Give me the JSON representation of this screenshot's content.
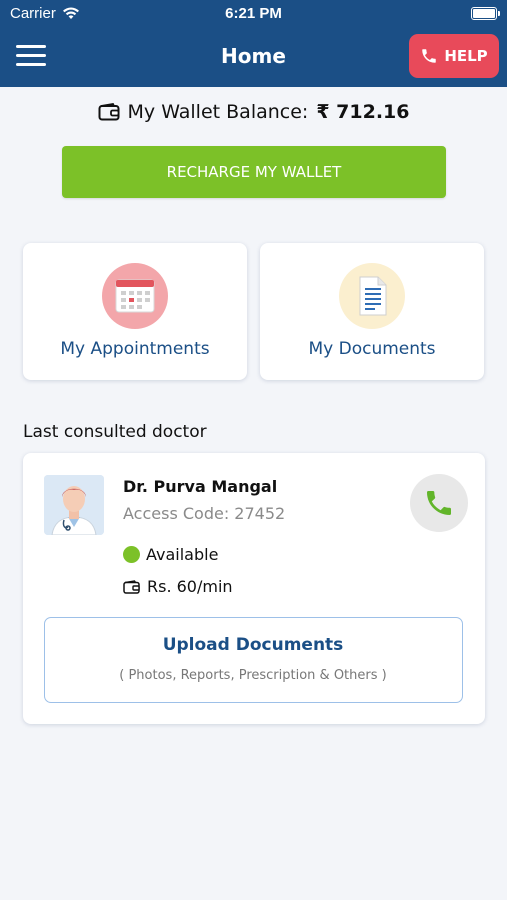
{
  "status_bar": {
    "carrier": "Carrier",
    "time": "6:21 PM"
  },
  "nav": {
    "title": "Home",
    "help_label": "HELP"
  },
  "wallet": {
    "label": "My Wallet Balance:",
    "amount": "₹ 712.16",
    "recharge_label": "RECHARGE MY WALLET"
  },
  "tiles": [
    {
      "label": "My Appointments",
      "icon": "calendar-icon"
    },
    {
      "label": "My Documents",
      "icon": "document-icon"
    }
  ],
  "last_consulted": {
    "heading": "Last consulted doctor",
    "doctor_name": "Dr. Purva Mangal",
    "access_code": "Access Code: 27452",
    "status": "Available",
    "rate": "Rs. 60/min",
    "upload_title": "Upload Documents",
    "upload_subtitle": "( Photos, Reports, Prescription & Others )"
  },
  "colors": {
    "primary": "#1b4f86",
    "help": "#e84a5a",
    "accent_green": "#7cc128",
    "background": "#f3f5f9"
  }
}
